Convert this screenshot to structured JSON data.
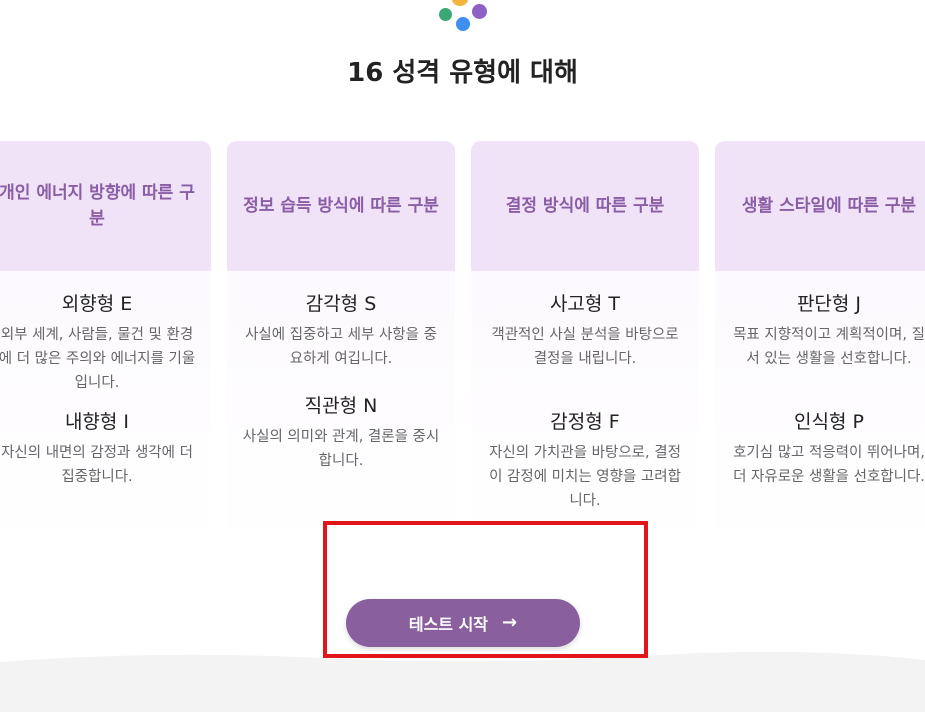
{
  "page": {
    "title": "16 성격 유형에 대해"
  },
  "cards": [
    {
      "heading": "개인 에너지 방향에 따른 구분",
      "types": [
        {
          "name": "외향형 E",
          "desc": "외부 세계, 사람들, 물건 및 환경에 더 많은 주의와 에너지를 기울입니다."
        },
        {
          "name": "내향형 I",
          "desc": "자신의 내면의 감정과 생각에 더 집중합니다."
        }
      ]
    },
    {
      "heading": "정보 습득 방식에 따른 구분",
      "types": [
        {
          "name": "감각형 S",
          "desc": "사실에 집중하고 세부 사항을 중요하게 여깁니다."
        },
        {
          "name": "직관형 N",
          "desc": "사실의 의미와 관계, 결론을 중시합니다."
        }
      ]
    },
    {
      "heading": "결정 방식에 따른 구분",
      "types": [
        {
          "name": "사고형 T",
          "desc": "객관적인 사실 분석을 바탕으로 결정을 내립니다."
        },
        {
          "name": "감정형 F",
          "desc": "자신의 가치관을 바탕으로, 결정이 감정에 미치는 영향을 고려합니다."
        }
      ]
    },
    {
      "heading": "생활 스타일에 따른 구분",
      "types": [
        {
          "name": "판단형 J",
          "desc": "목표 지향적이고 계획적이며, 질서 있는 생활을 선호합니다."
        },
        {
          "name": "인식형 P",
          "desc": "호기심 많고 적응력이 뛰어나며, 더 자유로운 생활을 선호합니다."
        }
      ]
    }
  ],
  "cta": {
    "label": "테스트 시작",
    "arrow": "→"
  },
  "colors": {
    "accent": "#8a5f9e",
    "card_header": "#f0e2f7",
    "heading_text": "#8a5ea6",
    "highlight": "#e0161b"
  }
}
